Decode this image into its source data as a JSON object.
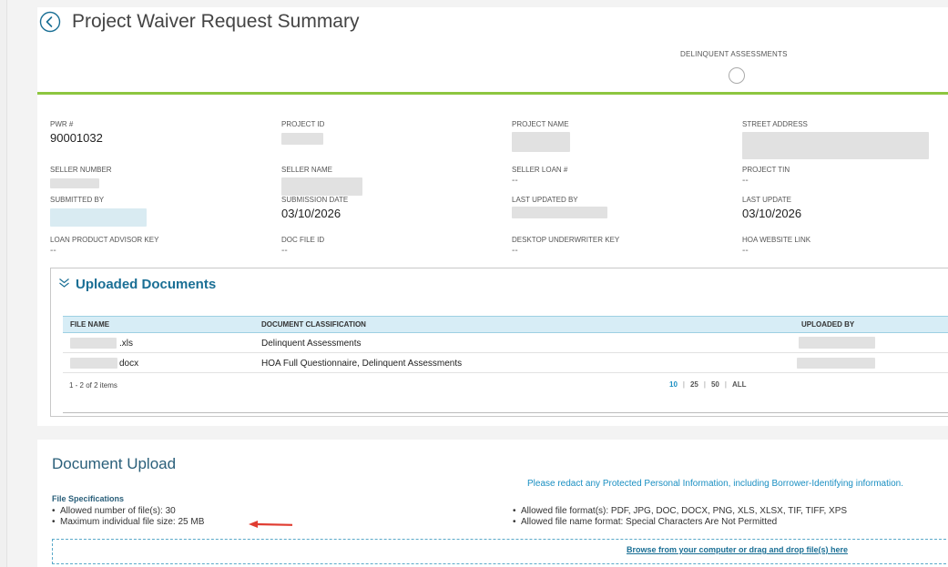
{
  "page": {
    "title": "Project Waiver Request Summary"
  },
  "header": {
    "delinquent_label": "DELINQUENT ASSESSMENTS"
  },
  "fields": {
    "pwr": {
      "label": "PWR #",
      "value": "90001032"
    },
    "project_id": {
      "label": "PROJECT ID"
    },
    "project_name": {
      "label": "PROJECT NAME"
    },
    "street_address": {
      "label": "STREET ADDRESS"
    },
    "seller_number": {
      "label": "SELLER NUMBER"
    },
    "seller_name": {
      "label": "SELLER NAME"
    },
    "seller_loan": {
      "label": "SELLER LOAN #",
      "value": "--"
    },
    "project_tin": {
      "label": "PROJECT TIN",
      "value": "--"
    },
    "submitted_by": {
      "label": "SUBMITTED BY"
    },
    "submission_date": {
      "label": "SUBMISSION DATE",
      "value": "03/10/2026"
    },
    "last_updated_by": {
      "label": "LAST UPDATED BY"
    },
    "last_update": {
      "label": "LAST UPDATE",
      "value": "03/10/2026"
    },
    "lpa_key": {
      "label": "LOAN PRODUCT ADVISOR KEY",
      "value": "--"
    },
    "doc_file_id": {
      "label": "DOC FILE ID",
      "value": "--"
    },
    "du_key": {
      "label": "DESKTOP UNDERWRITER KEY",
      "value": "--"
    },
    "hoa_link": {
      "label": "HOA WEBSITE LINK",
      "value": "--"
    }
  },
  "uploaded_documents": {
    "title": "Uploaded Documents",
    "columns": [
      "FILE NAME",
      "DOCUMENT CLASSIFICATION",
      "UPLOADED BY"
    ],
    "rows": [
      {
        "file_ext": ".xls",
        "classification": "Delinquent Assessments"
      },
      {
        "file_ext": "docx",
        "classification": "HOA Full Questionnaire, Delinquent Assessments"
      }
    ],
    "pager": {
      "count": "1 - 2 of 2 items",
      "sizes": [
        "10",
        "25",
        "50",
        "ALL"
      ],
      "active_size": "10"
    }
  },
  "document_upload": {
    "title": "Document Upload",
    "redact_note": "Please redact any Protected Personal Information, including Borrower-Identifying information.",
    "spec_heading": "File Specifications",
    "left_specs": [
      "Allowed number of file(s): 30",
      "Maximum individual file size: 25 MB"
    ],
    "right_specs": [
      "Allowed file format(s): PDF, JPG, DOC, DOCX, PNG, XLS, XLSX, TIF, TIFF, XPS",
      "Allowed file name format: Special Characters Are Not Permitted"
    ],
    "browse_link": "Browse from your computer or drag and drop file(s) here"
  },
  "colors": {
    "accent_green": "#8dc63f",
    "link_blue": "#1a8fc2",
    "header_blue": "#1a6f95",
    "annotation_red": "#e03c31"
  }
}
